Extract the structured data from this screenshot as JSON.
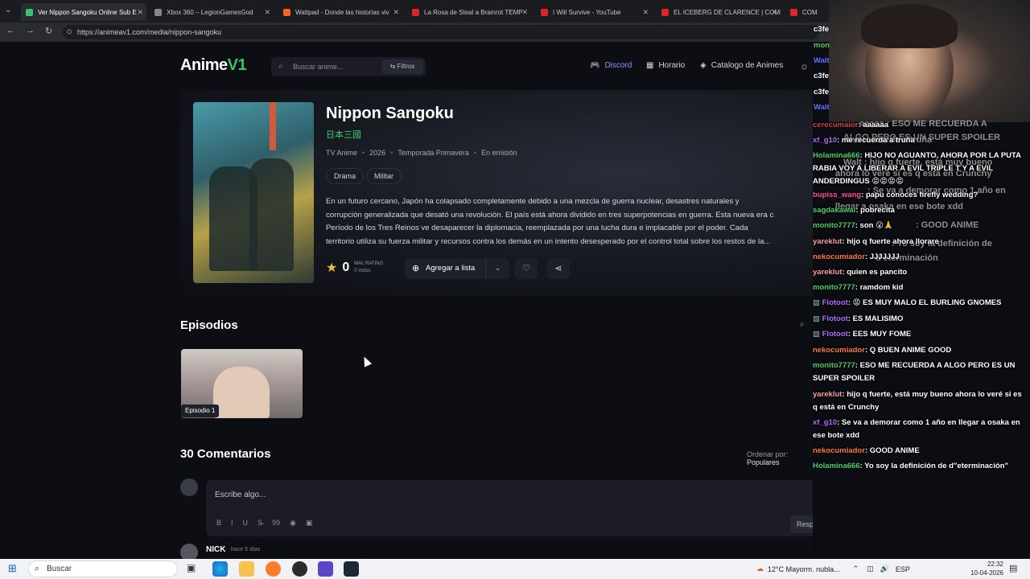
{
  "browser": {
    "tabs": [
      {
        "title": "Ver Nippon Sangoku Online Sub E",
        "color": "#39c46b",
        "active": true
      },
      {
        "title": "Xbox 360 – LegionGamesGod",
        "color": "#888888"
      },
      {
        "title": "Wattpad - Donde las historias viv",
        "color": "#ff6122"
      },
      {
        "title": "La Rosa de Steal a Brainrot TEMP",
        "color": "#e02424"
      },
      {
        "title": "I Will Survive - YouTube",
        "color": "#e02424"
      },
      {
        "title": "EL ICEBERG DE CLARENCE | COMP",
        "color": "#e02424"
      },
      {
        "title": "COMO VE",
        "color": "#e02424"
      }
    ],
    "url": "https://animeav1.com/media/nippon-sangoku"
  },
  "site": {
    "logo_text": "Anime",
    "logo_mark": "V1",
    "search_placeholder": "Buscar anime...",
    "filters_label": "Filtros",
    "nav": [
      {
        "label": "Discord",
        "icon": "discord-icon"
      },
      {
        "label": "Horario",
        "icon": "calendar-icon"
      },
      {
        "label": "Catalogo de Animes",
        "icon": "layers-icon"
      }
    ]
  },
  "anime": {
    "title": "Nippon Sangoku",
    "title_jp": "日本三國",
    "meta": [
      "TV Anime",
      "2026",
      "Temporada Primavera",
      "En emisión"
    ],
    "genres": [
      "Drama",
      "Militar"
    ],
    "synopsis_lines": [
      "En un futuro cercano, Japón ha colapsado completamente debido a una mezcla de guerra nuclear, desastres naturales y",
      "corrupción generalizada que desató una revolución. El país está ahora dividido en tres superpotencias en guerra. Esta nueva era c",
      "Período de los Tres Reinos ve desaparecer la diplomacia, reemplazada por una lucha dura e implacable por el poder. Cada",
      "territorio utiliza su fuerza militar y recursos contra los demás en un intento desesperado por el control total sobre los restos de la..."
    ],
    "rating_value": "0",
    "rating_label": "MAL RATING",
    "votes": "0 Votos",
    "add_to_list": "Agregar a lista"
  },
  "episodes": {
    "heading": "Episodios",
    "items": [
      {
        "label": "Episodio 1"
      }
    ]
  },
  "comments": {
    "heading": "30 Comentarios",
    "order_label": "Ordenar por:",
    "order_value": "Populares",
    "placeholder": "Escribe algo...",
    "toolbar": [
      "B",
      "I",
      "U",
      "S̶",
      "99",
      "◉",
      "▣"
    ],
    "reply_label": "Responder",
    "first_user": "NICK",
    "first_time": "hace 5 días"
  },
  "stream_chat": {
    "side_names": [
      {
        "name": "c3fe",
        "color": "#ffffff"
      },
      {
        "name": "mon",
        "color": "#4dd06a"
      },
      {
        "name": "Walt",
        "color": "#5b7bff"
      },
      {
        "name": "c3fe",
        "color": "#ffffff"
      },
      {
        "name": "c3fe",
        "color": "#ffffff"
      },
      {
        "name": "Walt",
        "color": "#5b7bff"
      }
    ],
    "ghost_lines": [
      "aaaaa : ESO ME RECUERDA A",
      "ALGO PERO ES UN SUPER SPOILER",
      "me recuerda a truña",
      "Walt : hijo q fuerte, está muy bueno",
      "ahora lo veré si es q está en Crunchy",
      ": Se va a demorar como 1 año en",
      "llegar a osaka en ese bote xdd",
      ": GOOD ANIME",
      ": Yo soy la definición de",
      "d'eterminación"
    ],
    "messages": [
      {
        "user": "cerecumaior",
        "color": "#d04343",
        "text": ": aaaaaa"
      },
      {
        "user": "xf_g10",
        "color": "#b36bff",
        "text": ": me recuerda a truña"
      },
      {
        "user": "Holamina666",
        "color": "#4dd06a",
        "text": ": HIJO NO AGUANTO, AHORA POR LA PUTA RABIA VOY A LIBERAR A EVIL TRIPLE T Y A EVIL ANDERDINGUS 😡😡😡😡"
      },
      {
        "user": "bupiss_wang",
        "color": "#ff4fa3",
        "text": ": papu conoces firefly wedding?"
      },
      {
        "user": "sagdakawai",
        "color": "#4dd06a",
        "text": ": pobrecita"
      },
      {
        "user": "monito7777",
        "color": "#4dd06a",
        "text": ": son 😮🙏"
      },
      {
        "user": "yareklut",
        "color": "#ff9f9f",
        "text": ": hijo q fuerte ahora llorare"
      },
      {
        "user": "nekocumiador",
        "color": "#ff7a3c",
        "text": ": JJJJJJJ"
      },
      {
        "user": "yareklut",
        "color": "#ff9f9f",
        "text": ": quien es pancito"
      },
      {
        "user": "monito7777",
        "color": "#4dd06a",
        "text": ": ramdom kid"
      },
      {
        "user": "Flotoot",
        "color": "#b36bff",
        "text": ": 😡 ES MUY MALO EL BURLING GNOMES"
      },
      {
        "user": "Flotoot",
        "color": "#b36bff",
        "text": ": ES MALISIMO"
      },
      {
        "user": "Flotoot",
        "color": "#b36bff",
        "text": ": EES MUY FOME"
      },
      {
        "user": "nekocumiador",
        "color": "#ff7a3c",
        "text": ": Q BUEN ANIME GOOD"
      },
      {
        "user": "monito7777",
        "color": "#4dd06a",
        "text": ": ESO ME RECUERDA A ALGO PERO ES UN SUPER SPOILER"
      },
      {
        "user": "yareklut",
        "color": "#ff9f9f",
        "text": ": hijo q fuerte, está muy bueno ahora lo veré si es q está en Crunchy"
      },
      {
        "user": "xf_g10",
        "color": "#b36bff",
        "text": ": Se va a demorar como 1 año en llegar a osaka en ese bote xdd"
      },
      {
        "user": "nekocumiador",
        "color": "#ff7a3c",
        "text": ": GOOD ANIME"
      },
      {
        "user": "Holamina666",
        "color": "#4dd06a",
        "text": ": Yo soy la definición de d\"eterminación\""
      }
    ]
  },
  "taskbar": {
    "search_label": "Buscar",
    "weather": "12°C  Mayorm. nubla...",
    "lang": "ESP",
    "time": "22:32",
    "date": "10-04-2026"
  }
}
